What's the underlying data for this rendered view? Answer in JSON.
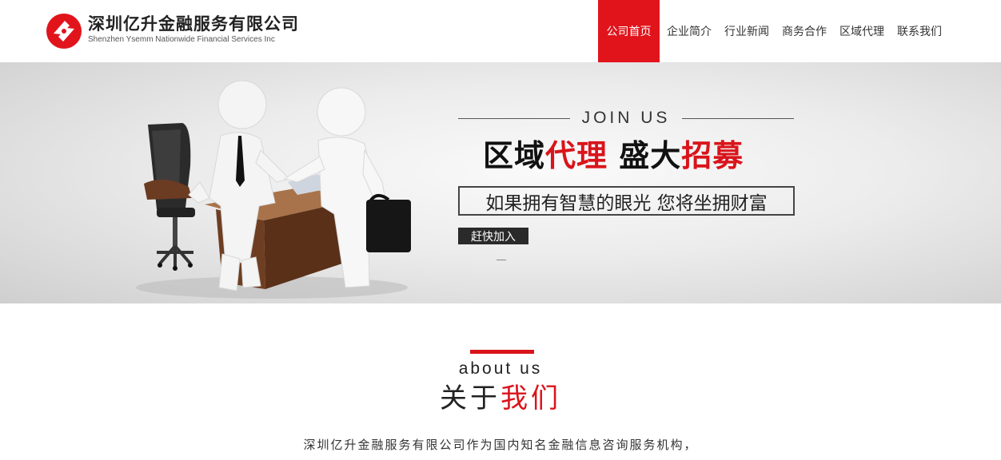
{
  "colors": {
    "brand_red": "#e1141c",
    "text_dark": "#222222",
    "button_dark": "#2a2a2a"
  },
  "header": {
    "logo_icon": "yisheng-logo-icon",
    "company_cn": "深圳亿升金融服务有限公司",
    "company_en": "Shenzhen Ysemm Nationwide Financial Services Inc"
  },
  "nav": {
    "items": [
      {
        "label": "公司首页",
        "active": true
      },
      {
        "label": "企业简介",
        "active": false
      },
      {
        "label": "行业新闻",
        "active": false
      },
      {
        "label": "商务合作",
        "active": false
      },
      {
        "label": "区域代理",
        "active": false
      },
      {
        "label": "联系我们",
        "active": false
      }
    ]
  },
  "banner": {
    "illustration": "handshake-figures-illustration",
    "join_us": "JOIN US",
    "headline_part1": "区域",
    "headline_part2": "代理",
    "headline_part3": "盛大",
    "headline_part4": "招募",
    "slogan": "如果拥有智慧的眼光 您将坐拥财富",
    "button_label": "赶快加入"
  },
  "about": {
    "en_title": "about us",
    "cn_title_part1": "关于",
    "cn_title_part2": "我们",
    "description": "深圳亿升金融服务有限公司作为国内知名金融信息咨询服务机构，"
  }
}
